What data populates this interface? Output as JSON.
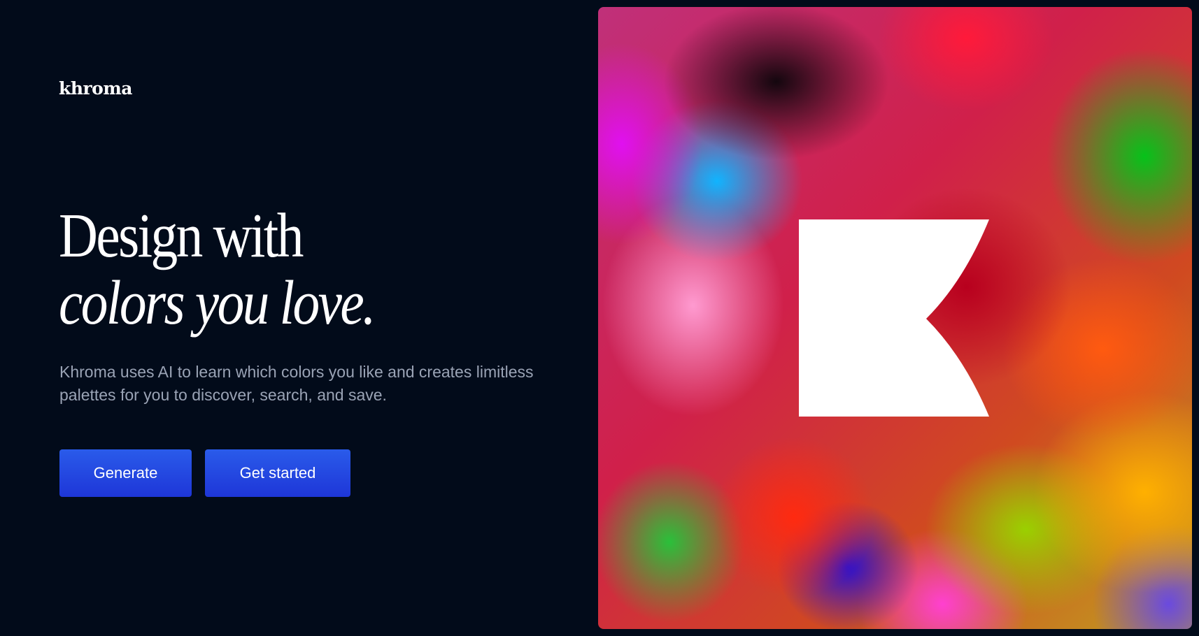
{
  "brand": {
    "logo": "khroma"
  },
  "hero": {
    "headline_line1": "Design with",
    "headline_line2": "colors you love.",
    "description": "Khroma uses AI to learn which colors you like and creates limitless palettes for you to discover, search, and save.",
    "buttons": {
      "generate_label": "Generate",
      "get_started_label": "Get started"
    }
  },
  "colors": {
    "background": "#020b1a",
    "button_primary": "#1e36d8",
    "description_text": "#9aa3b5",
    "k_mark_fill": "#ffffff"
  },
  "icons": {
    "hero_mark": "khroma-k-logo-icon"
  }
}
